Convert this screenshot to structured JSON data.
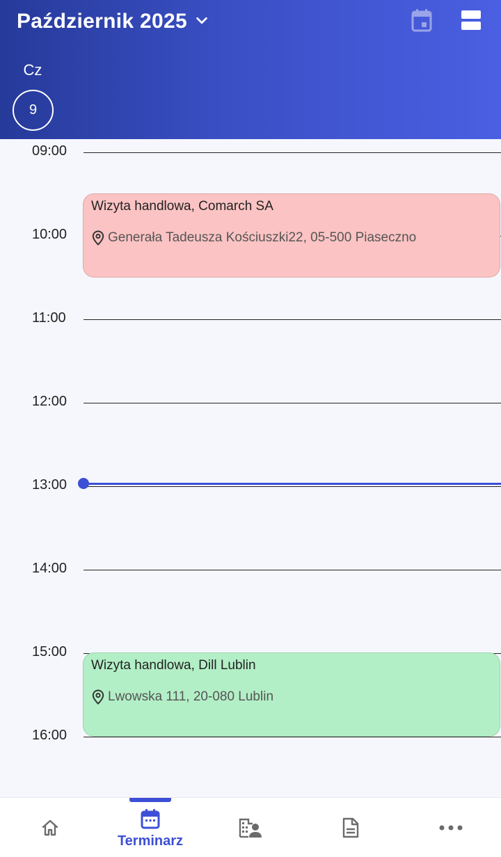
{
  "header": {
    "month_title": "Październik 2025",
    "weekday": "Cz",
    "day_number": "9"
  },
  "timeline": {
    "hours": [
      "09:00",
      "10:00",
      "11:00",
      "12:00",
      "13:00",
      "14:00",
      "15:00",
      "16:00"
    ],
    "events": [
      {
        "title": "Wizyta handlowa, Comarch SA",
        "location": "Generała Tadeusza Kościuszki22, 05-500 Piaseczno",
        "color": "#fbc3c3"
      },
      {
        "title": "Wizyta handlowa, Dill Lublin",
        "location": "Lwowska 111, 20-080 Lublin",
        "color": "#b3efc6"
      }
    ]
  },
  "bottom_nav": {
    "items": [
      {
        "icon": "home-icon",
        "label": ""
      },
      {
        "icon": "calendar-icon",
        "label": "Terminarz"
      },
      {
        "icon": "contacts-building-icon",
        "label": ""
      },
      {
        "icon": "document-icon",
        "label": ""
      },
      {
        "icon": "more-horizontal-icon",
        "label": ""
      }
    ],
    "active_index": 1
  },
  "colors": {
    "header_gradient_start": "#263a9a",
    "header_gradient_end": "#4a5fe2",
    "accent": "#3d4fd6",
    "event_red": "#fbc3c3",
    "event_green": "#b3efc6",
    "icon_gray": "#6b6b6b"
  }
}
